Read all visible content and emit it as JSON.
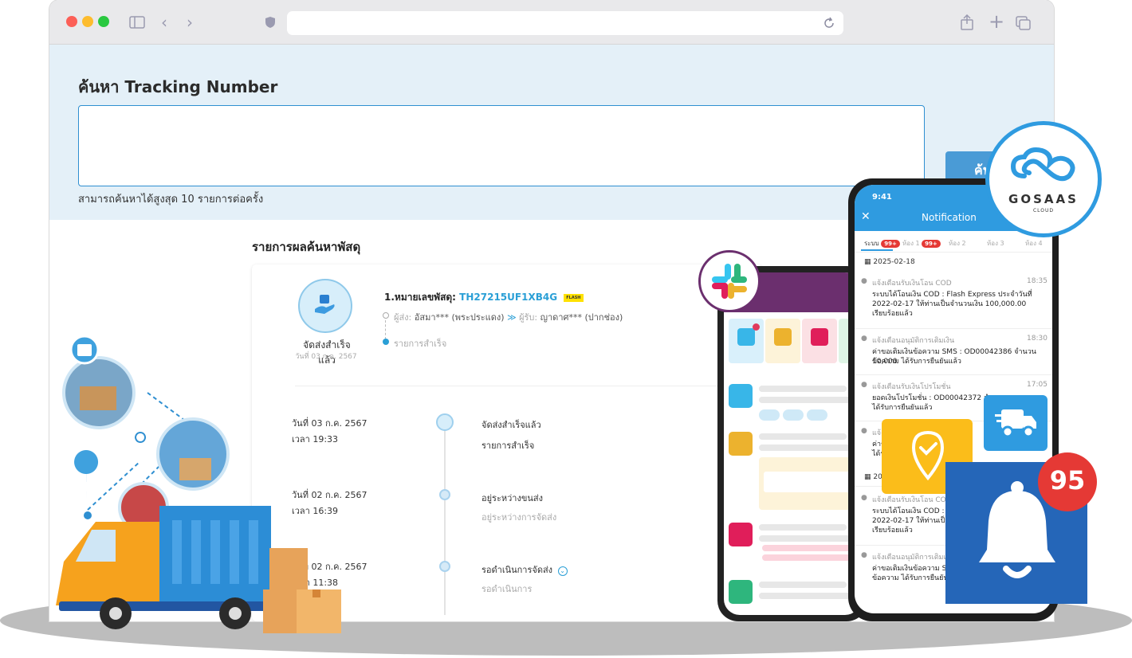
{
  "search": {
    "title": "ค้นหา Tracking Number",
    "placeholder": "",
    "hint": "สามารถค้นหาได้สูงสุด 10 รายการต่อครั้ง",
    "button_label": "ค้น"
  },
  "results": {
    "title": "รายการผลค้นหาพัสดุ",
    "item": {
      "status_label": "จัดส่งสำเร็จแล้ว",
      "status_date": "วันที่ 03 ก.ค. 2567",
      "tracking_prefix": "1.หมายเลขพัสดุ:",
      "tracking_number": "TH27215UF1XB4G",
      "carrier_logo_text": "FLASH",
      "sender_label": "ผู้ส่ง:",
      "sender": "อัสมา*** (พระประแดง)",
      "arrow": "≫",
      "receiver_label": "ผู้รับ:",
      "receiver": "ญาดาศ*** (ปากช่อง)",
      "summary": "รายการสำเร็จ"
    },
    "timeline": [
      {
        "date": "วันที่ 03 ก.ค. 2567",
        "time": "เวลา 19:33",
        "title": "จัดส่งสำเร็จแล้ว",
        "subtitle": "รายการสำเร็จ"
      },
      {
        "date": "วันที่ 02 ก.ค. 2567",
        "time": "เวลา 16:39",
        "title": "อยู่ระหว่างขนส่ง",
        "subtitle": "อยู่ระหว่างการจัดส่ง"
      },
      {
        "date": "วันที่ 02 ก.ค. 2567",
        "time": "เวลา 11:38",
        "title": "รอดำเนินการจัดส่ง",
        "subtitle": "รอดำเนินการ"
      }
    ]
  },
  "notification_app": {
    "clock": "9:41",
    "title": "Notification",
    "tabs": [
      {
        "label": "ระบบ",
        "badge": "99+"
      },
      {
        "label": "ห้อง 1",
        "badge": "99+"
      },
      {
        "label": "ห้อง 2",
        "badge": ""
      },
      {
        "label": "ห้อง 3",
        "badge": ""
      },
      {
        "label": "ห้อง 4",
        "badge": ""
      }
    ],
    "date_1": "2025-02-18",
    "items": [
      {
        "title": "แจ้งเตือนรับเงินโอน COD",
        "time": "18:35",
        "lines": [
          "ระบบได้โอนเงิน COD : Flash Express ประจำวันที่",
          "2022-02-17 ให้ท่านเป็นจำนวนเงิน 100,000.00",
          "เรียบร้อยแล้ว"
        ]
      },
      {
        "title": "แจ้งเตือนอนุมัติการเติมเงิน",
        "time": "18:30",
        "lines": [
          "ค่าขอเติมเงินข้อความ SMS : OD00042386 จำนวน 10,000",
          "ข้อความ ได้รับการยืนยันแล้ว"
        ]
      },
      {
        "title": "แจ้งเตือนรับเงินโปรโมชั่น",
        "time": "17:05",
        "lines": [
          "ยอดเงินโปรโมชั่น : OD00042372 จำนวน",
          "ได้รับการยืนยันแล้ว"
        ]
      },
      {
        "title": "แจ้ง",
        "time": "",
        "lines": [
          "ค่าข",
          "ได้รั"
        ]
      }
    ],
    "date_2": "20",
    "items_2": [
      {
        "title": "แจ้งเตือนรับเงินโอน COD",
        "lines": [
          "ระบบได้โอนเงิน COD : Fla",
          "2022-02-17 ให้ท่านเป็นจำ",
          "เรียบร้อยแล้ว"
        ]
      },
      {
        "title": "แจ้งเตือนอนุมัติการเติมเงิน",
        "lines": [
          "ค่าขอเติมเงินข้อความ SMS",
          "ข้อความ ได้รับการยืนยันแ"
        ]
      }
    ]
  },
  "bell_count": "95",
  "brand": {
    "name": "GOSAAS",
    "sub": "CLOUD"
  },
  "colors": {
    "accent": "#2a9fd6",
    "hero_bg": "#e4f0f8",
    "bell_blue": "#2566b8",
    "badge_red": "#e53935",
    "pin_yellow": "#fbbd1a",
    "slack_purple": "#6b2f6e"
  },
  "icons": [
    "sidebar-icon",
    "back-icon",
    "forward-icon",
    "shield-icon",
    "reload-icon",
    "share-icon",
    "plus-icon",
    "tabs-icon",
    "slack-icon",
    "bell-icon",
    "delivery-truck-icon",
    "location-check-icon",
    "package-icon",
    "location-pin-icon",
    "calendar-icon",
    "close-icon"
  ]
}
